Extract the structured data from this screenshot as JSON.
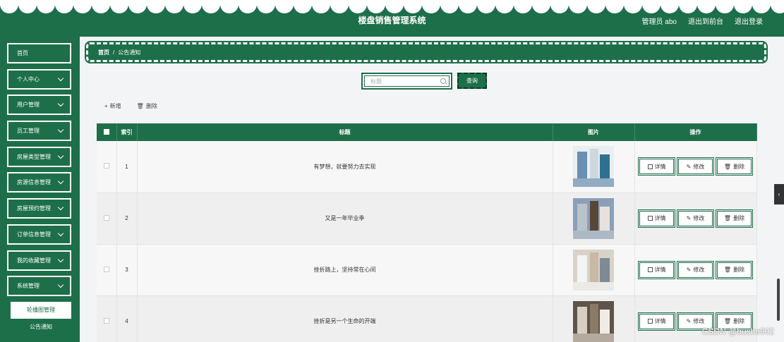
{
  "header": {
    "title": "楼盘销售管理系统",
    "user": "管理员 abo",
    "back_link": "退出到前台",
    "logout_link": "退出登录"
  },
  "sidebar": {
    "items": [
      {
        "label": "首页",
        "has_arrow": false
      },
      {
        "label": "个人中心",
        "has_arrow": true
      },
      {
        "label": "用户管理",
        "has_arrow": true
      },
      {
        "label": "员工管理",
        "has_arrow": true
      },
      {
        "label": "房屋类型管理",
        "has_arrow": true
      },
      {
        "label": "房源信息管理",
        "has_arrow": true
      },
      {
        "label": "房屋预约管理",
        "has_arrow": true
      },
      {
        "label": "订单信息管理",
        "has_arrow": true
      },
      {
        "label": "我的收藏管理",
        "has_arrow": true
      },
      {
        "label": "系统管理",
        "has_arrow": true
      }
    ],
    "subitems": [
      {
        "label": "轮播图管理"
      },
      {
        "label": "公告通知"
      }
    ]
  },
  "breadcrumb": {
    "home": "首页",
    "separator": "/",
    "current": "公告通知"
  },
  "search": {
    "placeholder": "标题",
    "button": "查询"
  },
  "toolbar": {
    "add": "新增",
    "delete": "删除"
  },
  "table": {
    "headers": {
      "index": "索引",
      "title": "标题",
      "image": "图片",
      "actions": "操作"
    },
    "rows": [
      {
        "index": "1",
        "title": "有梦想，就要努力去实现"
      },
      {
        "index": "2",
        "title": "又是一年毕业季"
      },
      {
        "index": "3",
        "title": "挫折路上，坚持常在心间"
      },
      {
        "index": "4",
        "title": "挫折是另一个生命的开端"
      }
    ],
    "actions": {
      "detail": "详情",
      "edit": "修改",
      "delete": "删除"
    }
  },
  "watermark": "CSDN @bushe902",
  "colors": {
    "primary": "#1d6f49"
  }
}
